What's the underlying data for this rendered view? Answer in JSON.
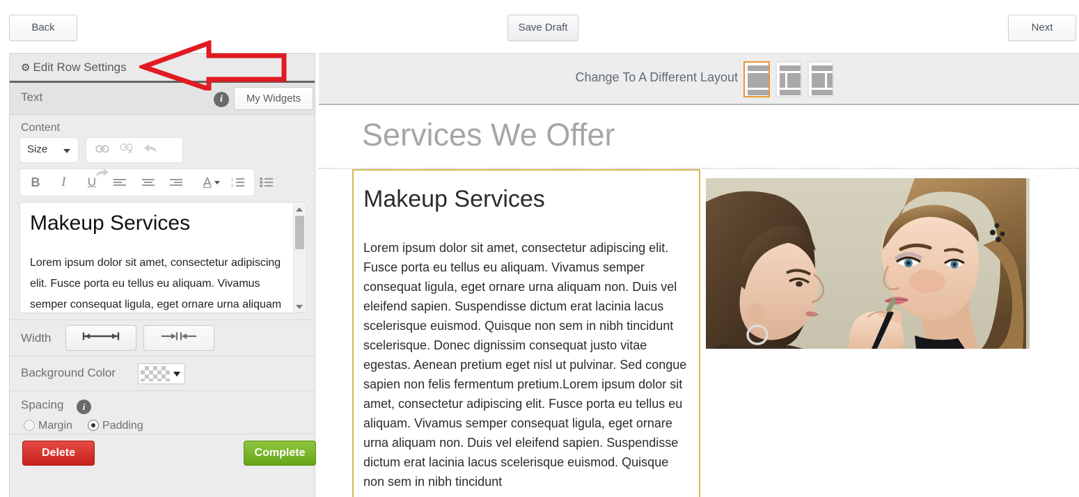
{
  "topbar": {
    "back_label": "Back",
    "save_draft_label": "Save Draft",
    "next_label": "Next"
  },
  "panel": {
    "header_label": "Edit Row Settings",
    "gear_icon": "gear-icon",
    "widget_type_label": "Text",
    "info_icon": "info-icon",
    "my_widgets_label": "My Widgets",
    "content_label": "Content",
    "toolbar": {
      "size_label": "Size",
      "dropdown_icon": "chevron-down-icon",
      "link_icon": "link-icon",
      "unlink_icon": "unlink-icon",
      "undo_icon": "undo-arrow-icon",
      "redo_icon": "redo-arrow-icon",
      "bold_label": "B",
      "italic_label": "I",
      "underline_label": "U",
      "align_left_icon": "align-left-icon",
      "align_center_icon": "align-center-icon",
      "align_right_icon": "align-right-icon",
      "font_color_label": "A",
      "ordered_list_icon": "ordered-list-icon",
      "unordered_list_icon": "unordered-list-icon"
    },
    "editor": {
      "heading": "Makeup Services",
      "paragraph": "Lorem ipsum dolor sit amet, consectetur adipiscing elit. Fusce porta eu tellus eu aliquam. Vivamus semper consequat ligula, eget ornare urna aliquam non."
    },
    "width": {
      "label": "Width",
      "full_icon": "width-full-icon",
      "narrow_icon": "width-narrow-icon",
      "selected": "full"
    },
    "background_color": {
      "label": "Background Color",
      "value": "transparent",
      "caret_icon": "chevron-down-icon"
    },
    "spacing": {
      "label": "Spacing",
      "info_icon": "info-icon",
      "margin_label": "Margin",
      "padding_label": "Padding",
      "selected": "Padding"
    },
    "footer": {
      "delete_label": "Delete",
      "complete_label": "Complete",
      "delete_color": "#c9201c",
      "complete_color": "#66a617"
    }
  },
  "annotation": {
    "arrow_icon": "left-arrow-annotation-icon",
    "color": "#e01b22"
  },
  "canvas": {
    "layout_bar": {
      "label": "Change To A Different Layout",
      "options": [
        {
          "name": "layout-full-width-icon",
          "selected": true
        },
        {
          "name": "layout-narrow-left-wide-right-icon",
          "selected": false
        },
        {
          "name": "layout-wide-left-narrow-right-icon",
          "selected": false
        }
      ],
      "selected_color": "#e8972e"
    },
    "page_title": "Services We Offer",
    "active_column_border_color": "#d8b455",
    "text_column": {
      "heading": "Makeup Services",
      "paragraph": "Lorem ipsum dolor sit amet, consectetur adipiscing elit. Fusce porta eu tellus eu aliquam. Vivamus semper consequat ligula, eget ornare urna aliquam non. Duis vel eleifend sapien. Suspendisse dictum erat lacinia lacus scelerisque euismod. Quisque non sem in nibh tincidunt scelerisque. Donec dignissim consequat justo vitae egestas. Aenean pretium eget nisl ut pulvinar. Sed congue sapien non felis fermentum pretium.Lorem ipsum dolor sit amet, consectetur adipiscing elit. Fusce porta eu tellus eu aliquam. Vivamus semper consequat ligula, eget ornare urna aliquam non. Duis vel eleifend sapien. Suspendisse dictum erat lacinia lacus scelerisque euismod. Quisque non sem in nibh tincidunt"
    },
    "image_column": {
      "image_name": "makeup-artist-applying-lipstick-photo"
    }
  }
}
